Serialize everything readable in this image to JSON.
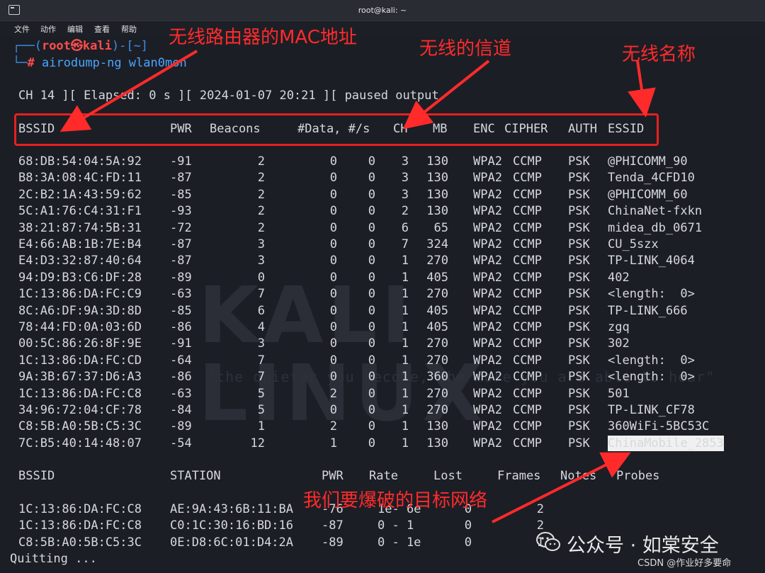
{
  "window": {
    "title": "root@kali: ~"
  },
  "menu": [
    "文件",
    "动作",
    "编辑",
    "查看",
    "帮助"
  ],
  "prompt": {
    "open": "┌──(",
    "user": "root㉿kali",
    "close": ")-[~]",
    "corner": "└─",
    "hash": "#",
    "command": "airodump-ng wlan0mon"
  },
  "status_line": "CH 14 ][ Elapsed: 0 s ][ 2024-01-07 20:21 ][ paused output",
  "ap_headers": [
    "BSSID",
    "PWR",
    "Beacons",
    "#Data, #/s",
    "CH",
    "MB",
    "ENC",
    "CIPHER",
    "AUTH",
    "ESSID"
  ],
  "ap_rows": [
    [
      "68:DB:54:04:5A:92",
      "-91",
      "2",
      "0",
      "0",
      "3",
      "130",
      "WPA2",
      "CCMP",
      "PSK",
      "@PHICOMM_90"
    ],
    [
      "B8:3A:08:4C:FD:11",
      "-87",
      "2",
      "0",
      "0",
      "3",
      "130",
      "WPA2",
      "CCMP",
      "PSK",
      "Tenda_4CFD10"
    ],
    [
      "2C:B2:1A:43:59:62",
      "-85",
      "2",
      "0",
      "0",
      "3",
      "130",
      "WPA2",
      "CCMP",
      "PSK",
      "@PHICOMM_60"
    ],
    [
      "5C:A1:76:C4:31:F1",
      "-93",
      "2",
      "0",
      "0",
      "2",
      "130",
      "WPA2",
      "CCMP",
      "PSK",
      "ChinaNet-fxkn"
    ],
    [
      "38:21:87:74:5B:31",
      "-72",
      "2",
      "0",
      "0",
      "6",
      "65",
      "WPA2",
      "CCMP",
      "PSK",
      "midea_db_0671"
    ],
    [
      "E4:66:AB:1B:7E:B4",
      "-87",
      "3",
      "0",
      "0",
      "7",
      "324",
      "WPA2",
      "CCMP",
      "PSK",
      "CU_5szx"
    ],
    [
      "E4:D3:32:87:40:64",
      "-87",
      "3",
      "0",
      "0",
      "1",
      "270",
      "WPA2",
      "CCMP",
      "PSK",
      "TP-LINK_4064"
    ],
    [
      "94:D9:B3:C6:DF:28",
      "-89",
      "0",
      "0",
      "0",
      "1",
      "405",
      "WPA2",
      "CCMP",
      "PSK",
      "402"
    ],
    [
      "1C:13:86:DA:FC:C9",
      "-63",
      "7",
      "0",
      "0",
      "1",
      "270",
      "WPA2",
      "CCMP",
      "PSK",
      "<length:  0>"
    ],
    [
      "8C:A6:DF:9A:3D:8D",
      "-85",
      "6",
      "0",
      "0",
      "1",
      "405",
      "WPA2",
      "CCMP",
      "PSK",
      "TP-LINK_666"
    ],
    [
      "78:44:FD:0A:03:6D",
      "-86",
      "4",
      "0",
      "0",
      "1",
      "405",
      "WPA2",
      "CCMP",
      "PSK",
      "zgq"
    ],
    [
      "00:5C:86:26:8F:9E",
      "-91",
      "3",
      "0",
      "0",
      "1",
      "270",
      "WPA2",
      "CCMP",
      "PSK",
      "302"
    ],
    [
      "1C:13:86:DA:FC:CD",
      "-64",
      "7",
      "0",
      "0",
      "1",
      "270",
      "WPA2",
      "CCMP",
      "PSK",
      "<length:  0>"
    ],
    [
      "9A:3B:67:37:D6:A3",
      "-86",
      "7",
      "0",
      "0",
      "1",
      "360",
      "WPA2",
      "CCMP",
      "PSK",
      "<length:  0>"
    ],
    [
      "1C:13:86:DA:FC:C8",
      "-63",
      "5",
      "2",
      "0",
      "1",
      "270",
      "WPA2",
      "CCMP",
      "PSK",
      "501"
    ],
    [
      "34:96:72:04:CF:78",
      "-84",
      "5",
      "0",
      "0",
      "1",
      "270",
      "WPA2",
      "CCMP",
      "PSK",
      "TP-LINK_CF78"
    ],
    [
      "C8:5B:A0:5B:C5:3C",
      "-89",
      "1",
      "2",
      "0",
      "1",
      "130",
      "WPA2",
      "CCMP",
      "PSK",
      "360WiFi-5BC53C"
    ],
    [
      "7C:B5:40:14:48:07",
      "-54",
      "12",
      "1",
      "0",
      "1",
      "130",
      "WPA2",
      "CCMP",
      "PSK",
      "ChinaMobile_2853"
    ]
  ],
  "station_headers": [
    "BSSID",
    "STATION",
    "PWR",
    "Rate",
    "Lost",
    "Frames",
    "Notes",
    "Probes"
  ],
  "station_rows": [
    [
      "1C:13:86:DA:FC:C8",
      "AE:9A:43:6B:11:BA",
      "-76",
      "1e- 6e",
      "0",
      "2"
    ],
    [
      "1C:13:86:DA:FC:C8",
      "C0:1C:30:16:BD:16",
      "-87",
      "0 - 1",
      "0",
      "2"
    ],
    [
      "C8:5B:A0:5B:C5:3C",
      "0E:D8:6C:01:D4:2A",
      "-89",
      "0 - 1e",
      "0",
      "1"
    ]
  ],
  "quitting": "Quitting ...",
  "watermark": {
    "logo": "KALI LINUX",
    "slogan": "\"the quieter you become, the more you are able to hear\""
  },
  "annotations": {
    "mac": "无线路由器的MAC地址",
    "channel": "无线的信道",
    "essid": "无线名称",
    "target": "我们要爆破的目标网络"
  },
  "footer": {
    "wechat": "公众号 · 如棠安全",
    "csdn": "CSDN @作业好多要命"
  },
  "colors": {
    "annotation": "#ff2b2b",
    "prompt_user": "#ff4d4d",
    "prompt_frame": "#3b8fe6",
    "command": "#4aa6ff"
  },
  "icons": [
    "terminal-icon",
    "wechat-icon"
  ]
}
